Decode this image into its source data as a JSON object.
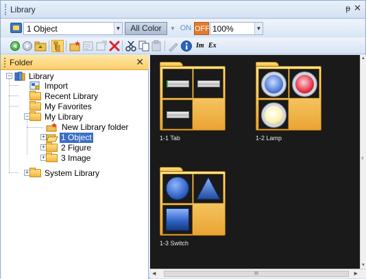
{
  "window": {
    "title": "Library",
    "pin_glyph": "ᵽ",
    "close_glyph": "✕"
  },
  "toolbar1": {
    "object_select": "1 Object",
    "color_mode": "All Color",
    "on_label": "ON",
    "off_label": "OFF",
    "zoom": "100%",
    "icons": [
      "object-selector-icon",
      "dropdown-arrow-icon"
    ]
  },
  "toolbar2": {
    "icons": [
      "back-icon",
      "forward-icon",
      "folder-up-icon",
      "tree-view-icon",
      "new-folder-icon",
      "properties-icon",
      "rename-icon",
      "delete-icon",
      "cut-icon",
      "copy-icon",
      "paste-icon",
      "edit-icon",
      "info-icon",
      "import-icon",
      "export-icon"
    ],
    "import_label": "Im",
    "export_label": "Ex"
  },
  "folder_panel": {
    "title": "Folder",
    "close_glyph": "✕",
    "tree": [
      {
        "label": "Library",
        "depth": 0,
        "expander": "−",
        "icon": "library-icon"
      },
      {
        "label": "Import",
        "depth": 1,
        "icon": "import-icon"
      },
      {
        "label": "Recent Library",
        "depth": 1,
        "icon": "folder-icon"
      },
      {
        "label": "My Favorites",
        "depth": 1,
        "icon": "folder-icon"
      },
      {
        "label": "My Library",
        "depth": 1,
        "expander": "−",
        "icon": "folder-icon"
      },
      {
        "label": "New Library folder",
        "depth": 2,
        "icon": "new-folder-icon"
      },
      {
        "label": "1 Object",
        "depth": 2,
        "expander": "+",
        "icon": "open-folder-icon",
        "selected": true
      },
      {
        "label": "2 Figure",
        "depth": 2,
        "expander": "+",
        "icon": "folder-icon"
      },
      {
        "label": "3 Image",
        "depth": 2,
        "expander": "+",
        "icon": "folder-icon"
      },
      {
        "label": "System Library",
        "depth": 0,
        "expander": "+",
        "icon": "folder-icon"
      }
    ]
  },
  "content": {
    "items": [
      {
        "caption": "1-1 Tab",
        "kind": "tab"
      },
      {
        "caption": "1-2 Lamp",
        "kind": "lamp"
      },
      {
        "caption": "1-3 Switch",
        "kind": "switch"
      }
    ],
    "hscroll_thumb_glyph": "III"
  },
  "colors": {
    "title_bar": "#dfe9f7",
    "folder_header": "#fbcf6b",
    "selection": "#3a6fc4",
    "content_bg": "#1a1a1a",
    "folder_yellow": "#f3b43a",
    "lamp_blue": "#3f6fd0",
    "lamp_red": "#e0283a",
    "lamp_yellow": "#fff1b0"
  }
}
